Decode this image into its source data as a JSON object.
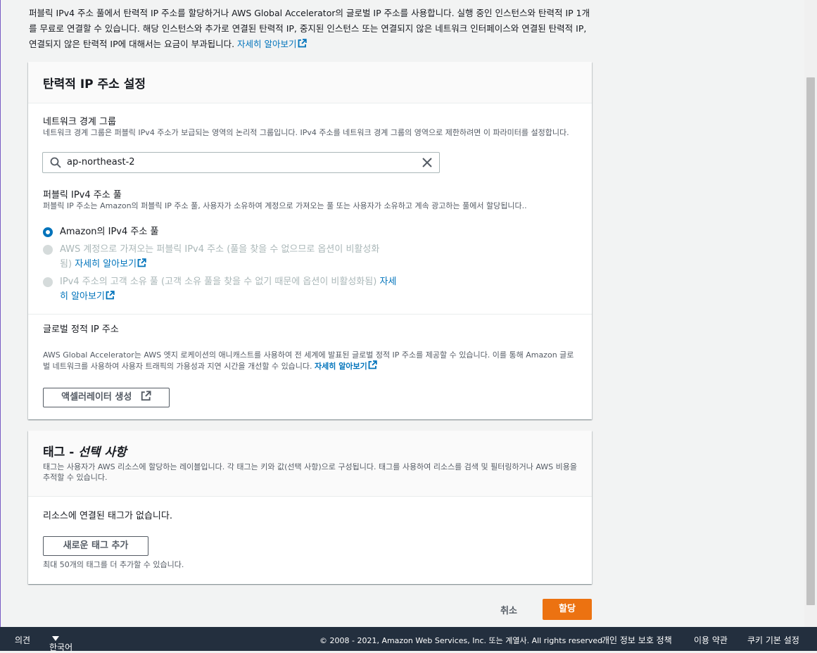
{
  "intro": {
    "text": "퍼블릭 IPv4 주소 풀에서 탄력적 IP 주소를 할당하거나 AWS Global Accelerator의 글로벌 IP 주소를 사용합니다. 실행 중인 인스턴스와 탄력적 IP 1개를 무료로 연결할 수 있습니다. 해당 인스턴스와 추가로 연결된 탄력적 IP, 중지된 인스턴스 또는 연결되지 않은 네트워크 인터페이스와 연결된 탄력적 IP, 연결되지 않은 탄력적 IP에 대해서는 요금이 부과됩니다.",
    "learn_more": "자세히 알아보기"
  },
  "settings": {
    "title": "탄력적 IP 주소 설정",
    "network_border_group": {
      "label": "네트워크 경계 그룹",
      "description": "네트워크 경계 그룹은 퍼블릭 IPv4 주소가 보급되는 영역의 논리적 그룹입니다. IPv4 주소를 네트워크 경계 그룹의 영역으로 제한하려면 이 파라미터를 설정합니다.",
      "value": "ap-northeast-2"
    },
    "ipv4_pool": {
      "label": "퍼블릭 IPv4 주소 풀",
      "description": "퍼블릭 IP 주소는 Amazon의 퍼블릭 IP 주소 풀, 사용자가 소유하여 계정으로 가져오는 풀 또는 사용자가 소유하고 계속 광고하는 풀에서 할당됩니다..",
      "options": [
        {
          "line1": "Amazon의 IPv4 주소 풀",
          "line2": "",
          "link": ""
        },
        {
          "line1": "AWS 계정으로 가져오는 퍼블릭 IPv4 주소 (풀을 찾을 수 없으므로 옵션이 비활성화",
          "line2": "됨)",
          "link": "자세히 알아보기"
        },
        {
          "line1": "IPv4 주소의 고객 소유 풀 (고객 소유 풀을 찾을 수 없기 때문에 옵션이 비활성화됨)",
          "link1": "자세",
          "link2": "히 알아보기"
        }
      ]
    },
    "global_static_ip": {
      "label": "글로벌 정적 IP 주소",
      "description": "AWS Global Accelerator는 AWS 엣지 로케이션의 애니캐스트를 사용하여 전 세계에 발표된 글로벌 정적 IP 주소를 제공할 수 있습니다. 이를 통해 Amazon 글로벌 네트워크를 사용하여 사용자 트래픽의 가용성과 지연 시간을 개선할 수 있습니다.",
      "learn_more": "자세히 알아보기",
      "button": "액셀러레이터 생성"
    }
  },
  "tags": {
    "title": "태그 -",
    "title_optional": "선택 사항",
    "description": "태그는 사용자가 AWS 리소스에 할당하는 레이블입니다. 각 태그는 키와 값(선택 사항)으로 구성됩니다. 태그를 사용하여 리소스를 검색 및 필터링하거나 AWS 비용을 추적할 수 있습니다.",
    "empty": "리소스에 연결된 태그가 없습니다.",
    "add_button": "새로운 태그 추가",
    "limit": "최대 50개의 태그를 더 추가할 수 있습니다."
  },
  "actions": {
    "cancel": "취소",
    "allocate": "할당"
  },
  "footer": {
    "feedback": "의견",
    "language": "한국어",
    "copyright": "© 2008 - 2021, Amazon Web Services, Inc. 또는 계열사. All rights reserved.",
    "privacy": "개인 정보 보호 정책",
    "terms": "이용 약관",
    "cookies": "쿠키 기본 설정"
  }
}
